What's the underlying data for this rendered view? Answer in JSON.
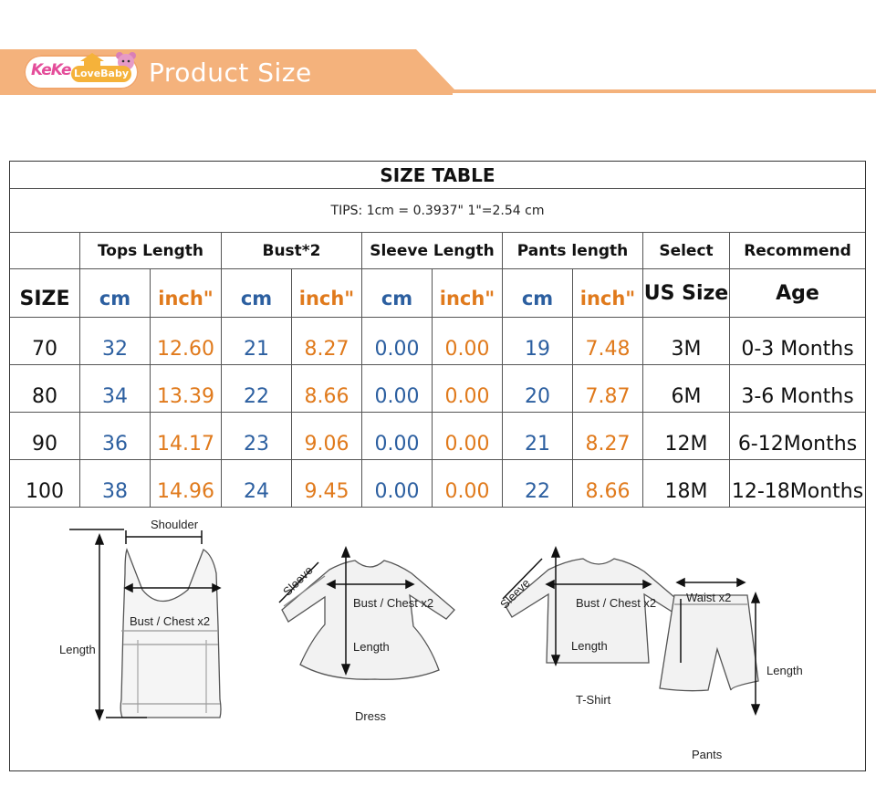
{
  "banner": {
    "title": "Product Size",
    "logo_text_1": "KeKe",
    "logo_text_2": "LoveBaby",
    "color": "#f4b27c"
  },
  "table": {
    "title": "SIZE TABLE",
    "tips": "TIPS: 1cm = 0.3937\"    1\"=2.54 cm",
    "headers": [
      "Tops Length",
      "Bust*2",
      "Sleeve Length",
      "Pants length",
      "Select",
      "Recommend"
    ],
    "subheaders": {
      "size": "SIZE",
      "cm": "cm",
      "inch": "inch\"",
      "us": "US Size",
      "age": "Age"
    },
    "rows": [
      {
        "size": "70",
        "tops_cm": "32",
        "tops_in": "12.60",
        "bust_cm": "21",
        "bust_in": "8.27",
        "sleeve_cm": "0.00",
        "sleeve_in": "0.00",
        "pants_cm": "19",
        "pants_in": "7.48",
        "us": "3M",
        "age": "0-3 Months"
      },
      {
        "size": "80",
        "tops_cm": "34",
        "tops_in": "13.39",
        "bust_cm": "22",
        "bust_in": "8.66",
        "sleeve_cm": "0.00",
        "sleeve_in": "0.00",
        "pants_cm": "20",
        "pants_in": "7.87",
        "us": "6M",
        "age": "3-6 Months"
      },
      {
        "size": "90",
        "tops_cm": "36",
        "tops_in": "14.17",
        "bust_cm": "23",
        "bust_in": "9.06",
        "sleeve_cm": "0.00",
        "sleeve_in": "0.00",
        "pants_cm": "21",
        "pants_in": "8.27",
        "us": "12M",
        "age": "6-12Months"
      },
      {
        "size": "100",
        "tops_cm": "38",
        "tops_in": "14.96",
        "bust_cm": "24",
        "bust_in": "9.45",
        "sleeve_cm": "0.00",
        "sleeve_in": "0.00",
        "pants_cm": "22",
        "pants_in": "8.66",
        "us": "18M",
        "age": "12-18Months"
      }
    ]
  },
  "diagram": {
    "vest": {
      "shoulder": "Shoulder",
      "bust": "Bust / Chest x2",
      "length": "Length"
    },
    "dress": {
      "sleeve": "Sleeve",
      "bust": "Bust / Chest x2",
      "length": "Length",
      "name": "Dress"
    },
    "tshirt": {
      "sleeve": "Sleeve",
      "bust": "Bust / Chest x2",
      "length": "Length",
      "name": "T-Shirt"
    },
    "pants": {
      "waist": "Waist x2",
      "length": "Length",
      "name": "Pants"
    }
  }
}
